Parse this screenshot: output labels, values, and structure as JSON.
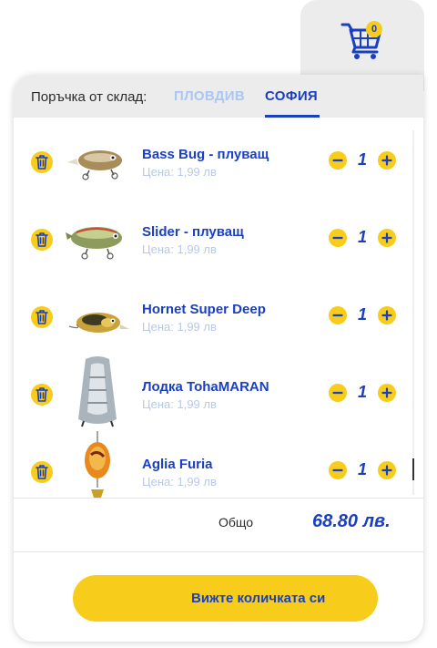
{
  "cart": {
    "count": "0",
    "icon": "shopping-cart-icon"
  },
  "order": {
    "label": "Поръчка от склад:",
    "tabs": [
      {
        "label": "ПЛОВДИВ",
        "active": false
      },
      {
        "label": "СОФИЯ",
        "active": true
      }
    ]
  },
  "items": [
    {
      "name": "Bass Bug - плуващ",
      "price": "Цена: 1,99 лв",
      "qty": "1"
    },
    {
      "name": "Slider - плуващ",
      "price": "Цена: 1,99 лв",
      "qty": "1"
    },
    {
      "name": "Hornet Super Deep",
      "price": "Цена: 1,99 лв",
      "qty": "1"
    },
    {
      "name": "Лодка TohaMARAN",
      "price": "Цена: 1,99 лв",
      "qty": "1"
    },
    {
      "name": "Aglia Furia",
      "price": "Цена: 1,99 лв",
      "qty": "1"
    }
  ],
  "total": {
    "label": "Общо",
    "value": "68.80 лв."
  },
  "cta": {
    "label": "Вижте количката си"
  },
  "colors": {
    "accent": "#f7cc1a",
    "brand": "#1a3fc2",
    "inactive_tab": "#a9c6f4",
    "price_text": "#b8c8e8"
  }
}
